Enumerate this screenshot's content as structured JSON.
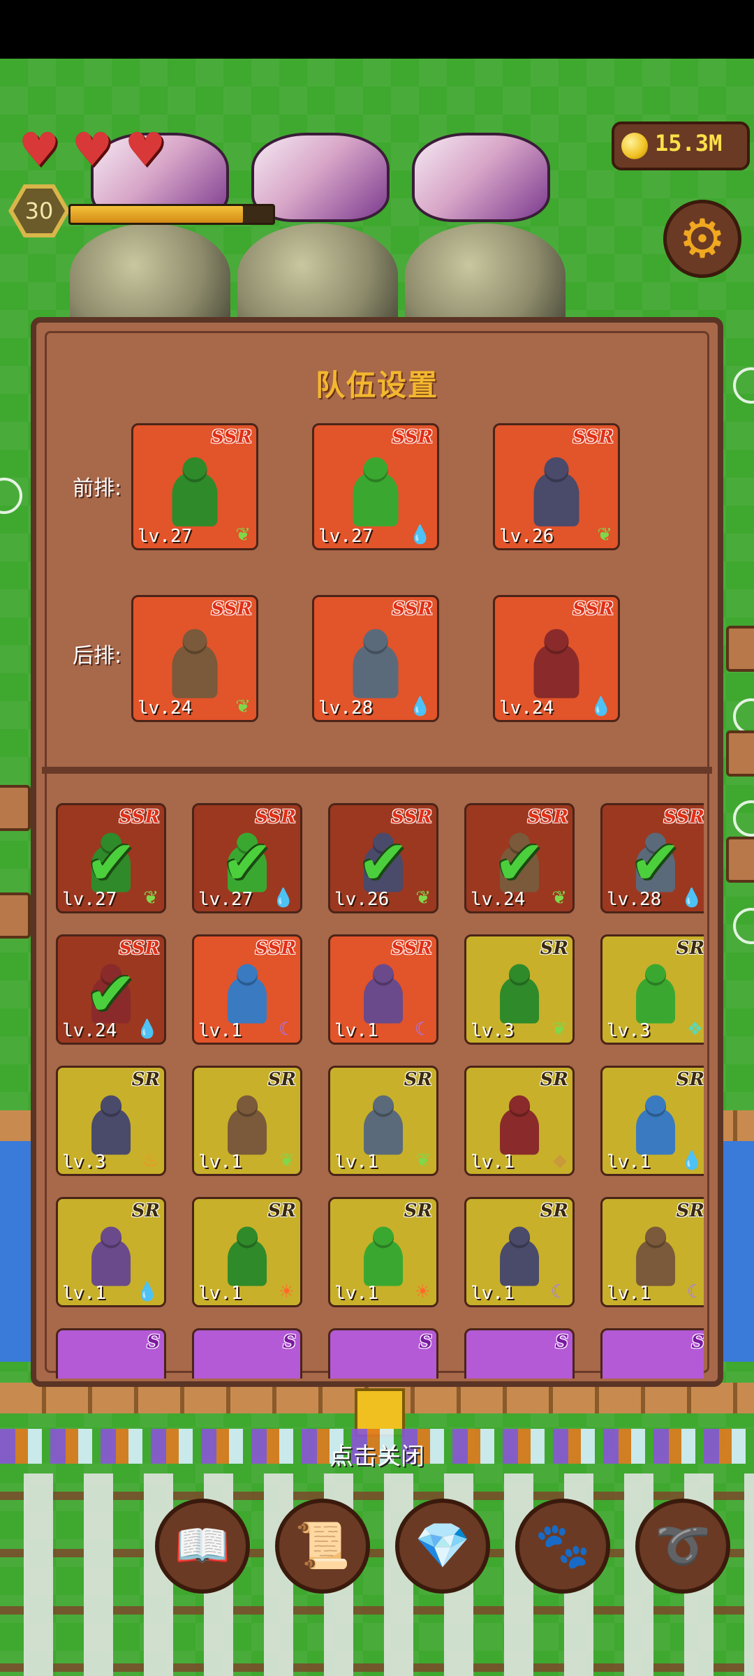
{
  "hud": {
    "hearts": 3,
    "player_level": "30",
    "xp_progress": 0.85,
    "coins": "15.3M"
  },
  "panel": {
    "title": "队伍设置",
    "front_label": "前排:",
    "back_label": "后排:",
    "front": [
      {
        "rarity": "SSR",
        "level": "lv.27",
        "element": "leaf"
      },
      {
        "rarity": "SSR",
        "level": "lv.27",
        "element": "water"
      },
      {
        "rarity": "SSR",
        "level": "lv.26",
        "element": "leaf"
      }
    ],
    "back": [
      {
        "rarity": "SSR",
        "level": "lv.24",
        "element": "leaf"
      },
      {
        "rarity": "SSR",
        "level": "lv.28",
        "element": "water"
      },
      {
        "rarity": "SSR",
        "level": "lv.24",
        "element": "water"
      }
    ],
    "roster": [
      {
        "rarity": "SSR",
        "level": "lv.27",
        "element": "leaf",
        "selected": true
      },
      {
        "rarity": "SSR",
        "level": "lv.27",
        "element": "water",
        "selected": true
      },
      {
        "rarity": "SSR",
        "level": "lv.26",
        "element": "leaf",
        "selected": true
      },
      {
        "rarity": "SSR",
        "level": "lv.24",
        "element": "leaf",
        "selected": true
      },
      {
        "rarity": "SSR",
        "level": "lv.28",
        "element": "water",
        "selected": true
      },
      {
        "rarity": "SSR",
        "level": "lv.24",
        "element": "water",
        "selected": true
      },
      {
        "rarity": "SSR",
        "level": "lv.1",
        "element": "moon",
        "selected": false
      },
      {
        "rarity": "SSR",
        "level": "lv.1",
        "element": "moon",
        "selected": false
      },
      {
        "rarity": "SR",
        "level": "lv.3",
        "element": "leaf",
        "selected": false
      },
      {
        "rarity": "SR",
        "level": "lv.3",
        "element": "wind",
        "selected": false
      },
      {
        "rarity": "SR",
        "level": "lv.3",
        "element": "fire",
        "selected": false
      },
      {
        "rarity": "SR",
        "level": "lv.1",
        "element": "leaf",
        "selected": false
      },
      {
        "rarity": "SR",
        "level": "lv.1",
        "element": "leaf",
        "selected": false
      },
      {
        "rarity": "SR",
        "level": "lv.1",
        "element": "earth",
        "selected": false
      },
      {
        "rarity": "SR",
        "level": "lv.1",
        "element": "water",
        "selected": false
      },
      {
        "rarity": "SR",
        "level": "lv.1",
        "element": "water",
        "selected": false
      },
      {
        "rarity": "SR",
        "level": "lv.1",
        "element": "sun",
        "selected": false
      },
      {
        "rarity": "SR",
        "level": "lv.1",
        "element": "sun",
        "selected": false
      },
      {
        "rarity": "SR",
        "level": "lv.1",
        "element": "moon",
        "selected": false
      },
      {
        "rarity": "SR",
        "level": "lv.1",
        "element": "moon",
        "selected": false
      },
      {
        "rarity": "S",
        "level": "",
        "element": "",
        "selected": false
      },
      {
        "rarity": "S",
        "level": "",
        "element": "",
        "selected": false
      },
      {
        "rarity": "S",
        "level": "",
        "element": "",
        "selected": false
      },
      {
        "rarity": "S",
        "level": "",
        "element": "",
        "selected": false
      },
      {
        "rarity": "S",
        "level": "",
        "element": "",
        "selected": false
      }
    ]
  },
  "close_hint": "点击关闭",
  "bottom_nav": [
    {
      "name": "book-icon"
    },
    {
      "name": "map-scroll-icon"
    },
    {
      "name": "diamond-coin-icon"
    },
    {
      "name": "paw-icon"
    },
    {
      "name": "whip-icon"
    }
  ],
  "colors": {
    "panel_bg": "#a8684a",
    "title": "#f3b730",
    "ssr_card": "#e2542a",
    "sr_card": "#c8b02a",
    "s_card": "#b45ad6"
  }
}
